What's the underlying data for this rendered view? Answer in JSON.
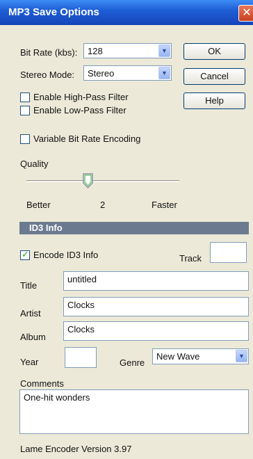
{
  "window": {
    "title": "MP3 Save Options",
    "close_glyph": "✕"
  },
  "bitrate": {
    "label": "Bit Rate (kbs):",
    "value": "128"
  },
  "stereo": {
    "label": "Stereo Mode:",
    "value": "Stereo"
  },
  "buttons": {
    "ok": "OK",
    "cancel": "Cancel",
    "help": "Help"
  },
  "filters": {
    "highpass": {
      "label": "Enable High-Pass Filter",
      "checked": false
    },
    "lowpass": {
      "label": "Enable Low-Pass Filter",
      "checked": false
    }
  },
  "vbr": {
    "label": "Variable Bit Rate Encoding",
    "checked": false
  },
  "quality": {
    "label": "Quality",
    "better": "Better",
    "value": "2",
    "faster": "Faster",
    "level": 0.4
  },
  "id3": {
    "section_title": "ID3 Info",
    "encode_label": "Encode ID3 Info",
    "encode_checked": true,
    "track_label": "Track",
    "track_value": "",
    "title_label": "Title",
    "title_value": "untitled",
    "artist_label": "Artist",
    "artist_value": "Clocks",
    "album_label": "Album",
    "album_value": "Clocks",
    "year_label": "Year",
    "year_value": "",
    "genre_label": "Genre",
    "genre_value": "New Wave",
    "comments_label": "Comments",
    "comments_value": "One-hit wonders"
  },
  "footer": {
    "encoder_version": "Lame Encoder Version 3.97"
  },
  "icons": {
    "dropdown": "chevron-down-icon",
    "close": "close-icon",
    "check": "checkmark-icon"
  }
}
